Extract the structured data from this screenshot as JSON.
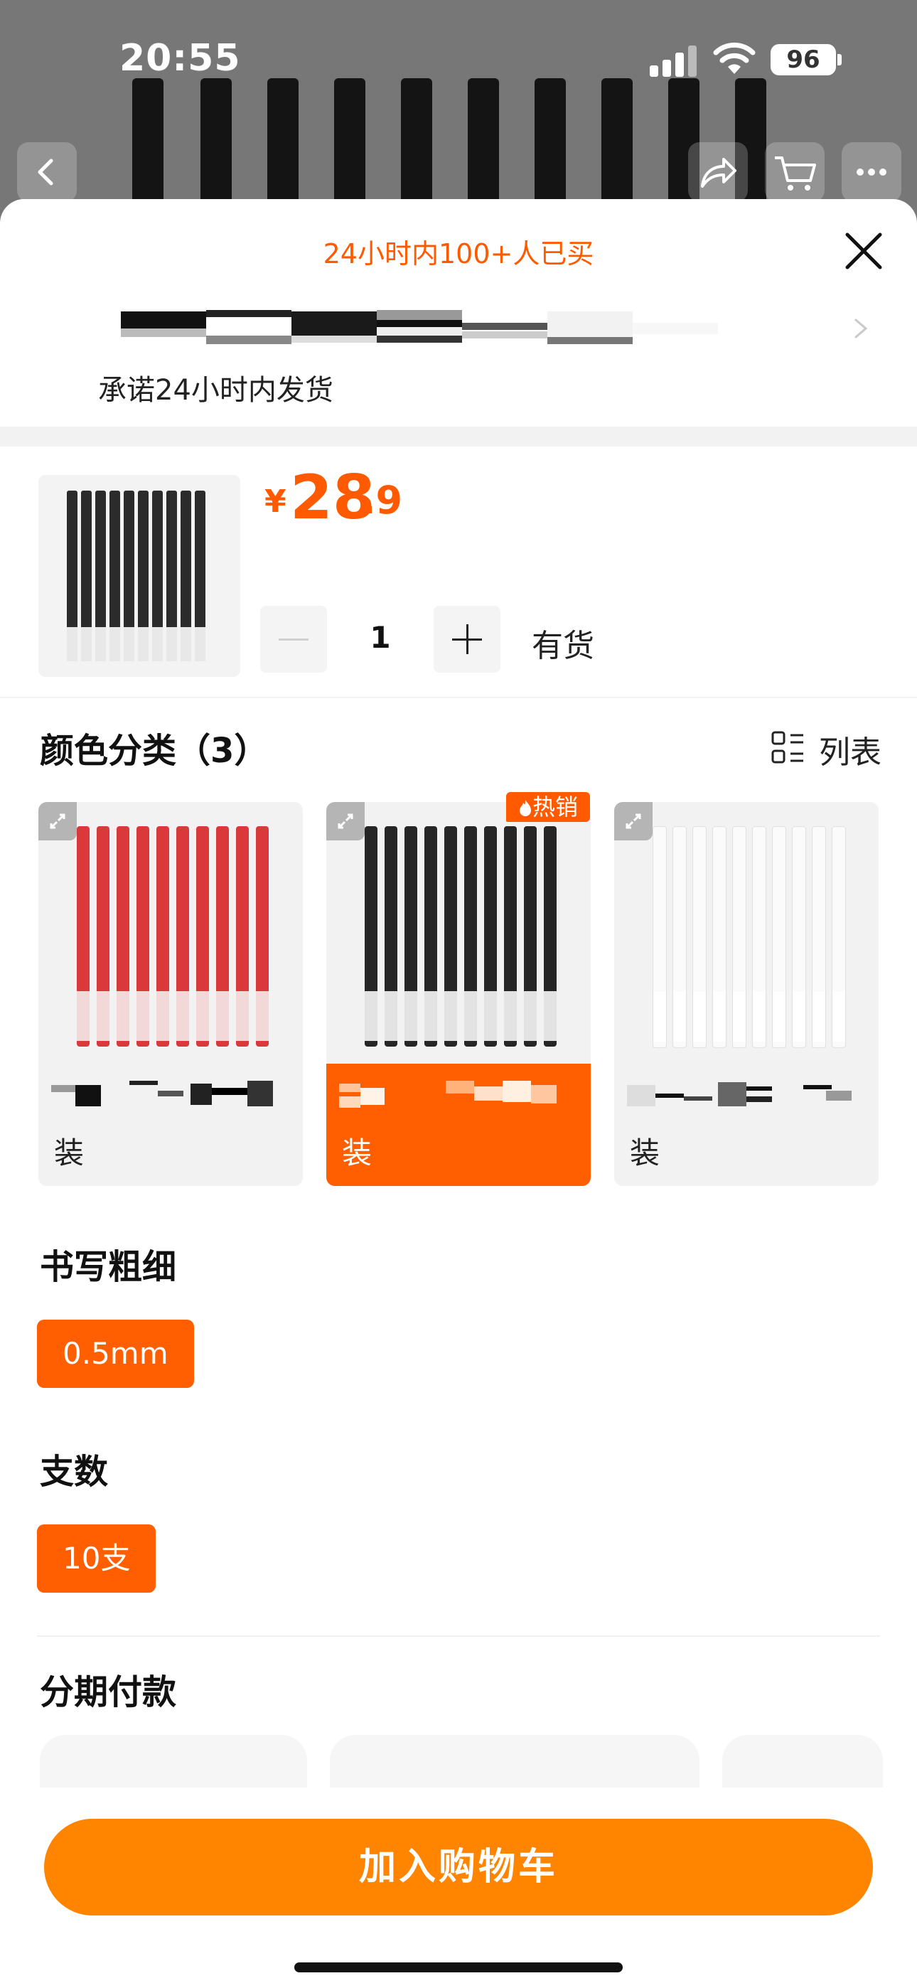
{
  "status_bar": {
    "time": "20:55",
    "battery": "96"
  },
  "sheet": {
    "banner": "24小时内100+人已买",
    "promise": "承诺24小时内发货"
  },
  "product": {
    "currency": "¥",
    "price_int": "28",
    "price_dec": ".9",
    "quantity": "1",
    "stock": "有货"
  },
  "color_section": {
    "title": "颜色分类（3）",
    "list_label": "列表",
    "hot_badge": "热销",
    "options": [
      {
        "suffix": "装",
        "pen_color": "#d9393a",
        "selected": false
      },
      {
        "suffix": "装",
        "pen_color": "#262626",
        "selected": true
      },
      {
        "suffix": "装",
        "pen_color": "#f7f7f7",
        "selected": false
      }
    ]
  },
  "thickness": {
    "title": "书写粗细",
    "option": "0.5mm"
  },
  "count": {
    "title": "支数",
    "option": "10支"
  },
  "installment": {
    "title": "分期付款"
  },
  "add_to_cart": "加入购物车",
  "colors": {
    "accent": "#ff5a00",
    "cart_button": "#ff8400"
  }
}
